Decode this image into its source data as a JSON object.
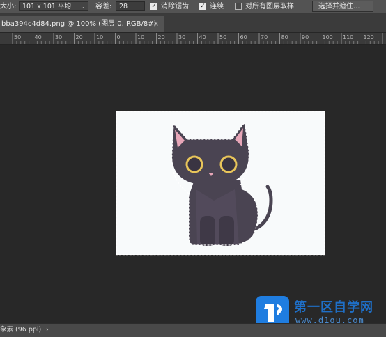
{
  "options_bar": {
    "sample_size_label": "大小:",
    "sample_size_value": "101 x 101 平均",
    "tolerance_label": "容差:",
    "tolerance_value": "28",
    "anti_alias_label": "消除锯齿",
    "anti_alias_checked": true,
    "contiguous_label": "连续",
    "contiguous_checked": true,
    "sample_all_layers_label": "对所有图层取样",
    "sample_all_layers_checked": false,
    "select_and_mask_label": "选择并遮住..."
  },
  "document_tab": {
    "title": "bba394c4d84.png @ 100% (图层 0, RGB/8#)",
    "close_glyph": "×"
  },
  "ruler": {
    "labels": [
      "50",
      "40",
      "30",
      "20",
      "10",
      "0",
      "10",
      "20",
      "30",
      "40",
      "50",
      "60",
      "70",
      "80",
      "90",
      "100",
      "110",
      "120"
    ]
  },
  "watermark": {
    "title": "第一区自学网",
    "url": "www.d1qu.com"
  },
  "status_bar": {
    "text": "象素 (96 ppi)",
    "chevron": "›"
  },
  "colors": {
    "app_bg": "#282828",
    "options_bg": "#535353",
    "canvas_bg": "#f8fafb",
    "cat_body": "#4a4452",
    "cat_eye_ring": "#e8c55a",
    "cat_ear_inner": "#e7a6b8",
    "watermark_blue": "#1f7de0"
  }
}
